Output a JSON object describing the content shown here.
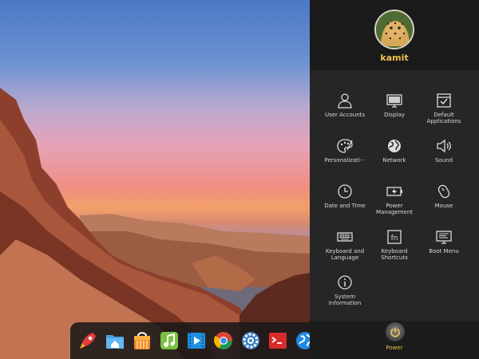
{
  "user": {
    "name": "kamit"
  },
  "settings": [
    {
      "key": "user-accounts",
      "label": "User Accounts",
      "icon": "user-icon"
    },
    {
      "key": "display",
      "label": "Display",
      "icon": "monitor-icon"
    },
    {
      "key": "default-applications",
      "label": "Default Applications",
      "icon": "checkbox-icon"
    },
    {
      "key": "personalization",
      "label": "Personalizati···",
      "icon": "palette-icon"
    },
    {
      "key": "network",
      "label": "Network",
      "icon": "globe-icon"
    },
    {
      "key": "sound",
      "label": "Sound",
      "icon": "speaker-icon"
    },
    {
      "key": "date-and-time",
      "label": "Date and Time",
      "icon": "clock-icon"
    },
    {
      "key": "power-management",
      "label": "Power Management",
      "icon": "battery-icon"
    },
    {
      "key": "mouse",
      "label": "Mouse",
      "icon": "mouse-icon"
    },
    {
      "key": "keyboard-and-language",
      "label": "Keyboard and Language",
      "icon": "keyboard-icon"
    },
    {
      "key": "keyboard-shortcuts",
      "label": "Keyboard Shortcuts",
      "icon": "fn-key-icon"
    },
    {
      "key": "boot-menu",
      "label": "Boot Menu",
      "icon": "boot-menu-icon"
    },
    {
      "key": "system-information",
      "label": "System Information",
      "icon": "info-icon"
    }
  ],
  "power": {
    "label": "Power"
  },
  "dock": [
    {
      "name": "rocket-launcher-icon"
    },
    {
      "name": "home-folder-icon"
    },
    {
      "name": "store-bag-icon"
    },
    {
      "name": "music-player-icon"
    },
    {
      "name": "video-player-icon"
    },
    {
      "name": "chrome-browser-icon"
    },
    {
      "name": "control-center-gear-icon"
    },
    {
      "name": "terminal-icon"
    },
    {
      "name": "web-browser-icon"
    },
    {
      "name": "partial-app-icon"
    }
  ],
  "colors": {
    "accent": "#f1c24d",
    "panel": "#262626",
    "panel_header": "#1a1a1a",
    "label": "#d9d9d9"
  }
}
